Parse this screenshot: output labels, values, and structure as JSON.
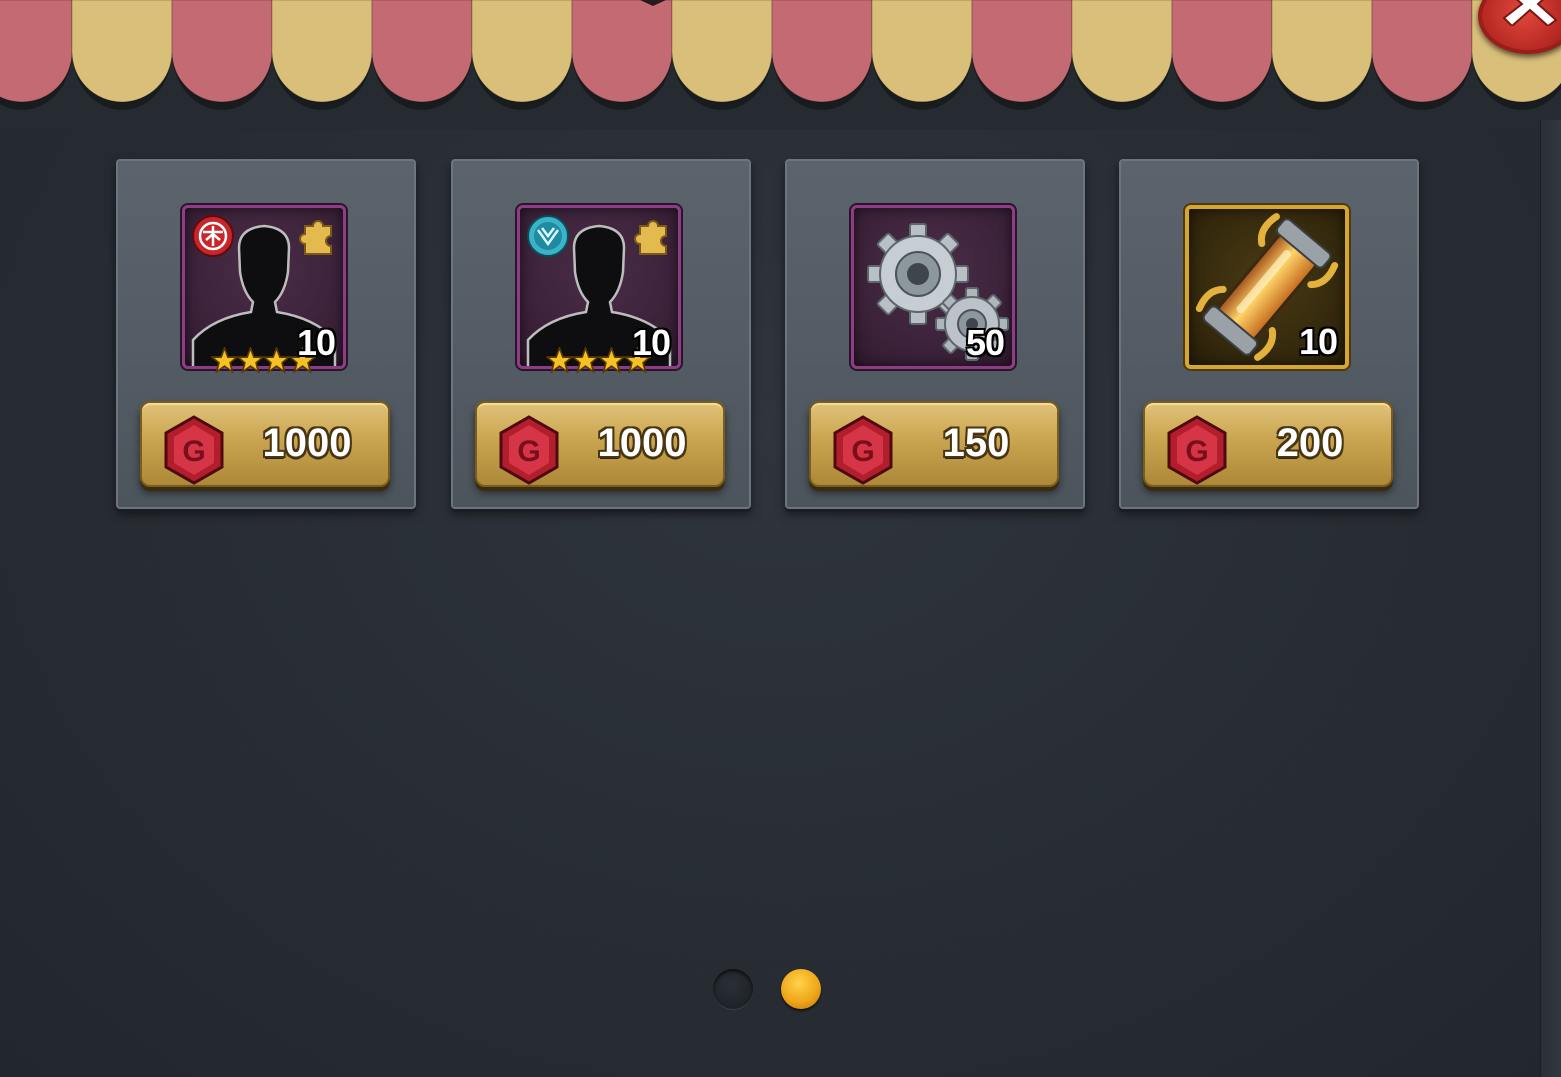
{
  "shop": {
    "items": [
      {
        "quantity": "10",
        "price": "1000",
        "stars": 4,
        "item": "champion-shard",
        "faction": "red"
      },
      {
        "quantity": "10",
        "price": "1000",
        "stars": 4,
        "item": "champion-shard",
        "faction": "teal"
      },
      {
        "quantity": "50",
        "price": "150",
        "item": "gears"
      },
      {
        "quantity": "10",
        "price": "200",
        "item": "energy-vial"
      }
    ],
    "currency_icon": "g-gem-icon"
  },
  "pagination": {
    "pages": 2,
    "current": 2
  },
  "colors": {
    "accent": "#f0a71a",
    "button": "#c9a550",
    "rarity_purple": "#8c3d86",
    "rarity_gold": "#d7a632"
  }
}
